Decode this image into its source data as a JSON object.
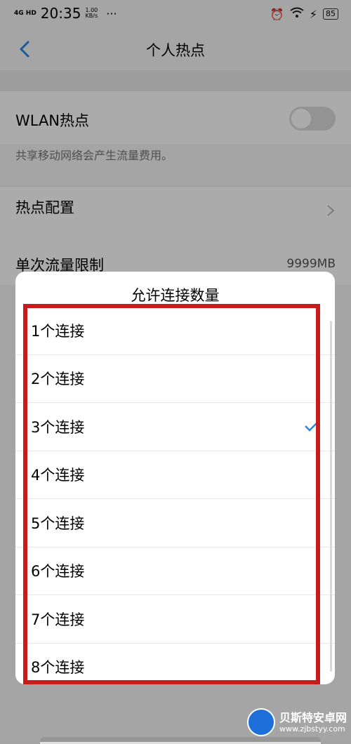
{
  "status_bar": {
    "network": "4G HD",
    "time": "20:35",
    "speed_value": "1.00",
    "speed_unit": "KB/s",
    "more": "···",
    "battery": "85"
  },
  "header": {
    "title": "个人热点"
  },
  "settings": {
    "wlan_hotspot_label": "WLAN热点",
    "wlan_hotspot_on": false,
    "fee_note": "共享移动网络会产生流量费用。",
    "hotspot_config_label": "热点配置",
    "data_limit_label": "单次流量限制",
    "data_limit_value": "9999MB"
  },
  "dialog": {
    "title": "允许连接数量",
    "options": [
      {
        "label": "1个连接",
        "selected": false
      },
      {
        "label": "2个连接",
        "selected": false
      },
      {
        "label": "3个连接",
        "selected": true
      },
      {
        "label": "4个连接",
        "selected": false
      },
      {
        "label": "5个连接",
        "selected": false
      },
      {
        "label": "6个连接",
        "selected": false
      },
      {
        "label": "7个连接",
        "selected": false
      },
      {
        "label": "8个连接",
        "selected": false
      }
    ]
  },
  "watermark": {
    "name": "贝斯特安卓网",
    "url": "www.zjbstyy.com"
  },
  "colors": {
    "accent": "#2b86e0",
    "highlight": "#c81b1b",
    "dim_overlay": "rgba(0,0,0,0.33)"
  }
}
